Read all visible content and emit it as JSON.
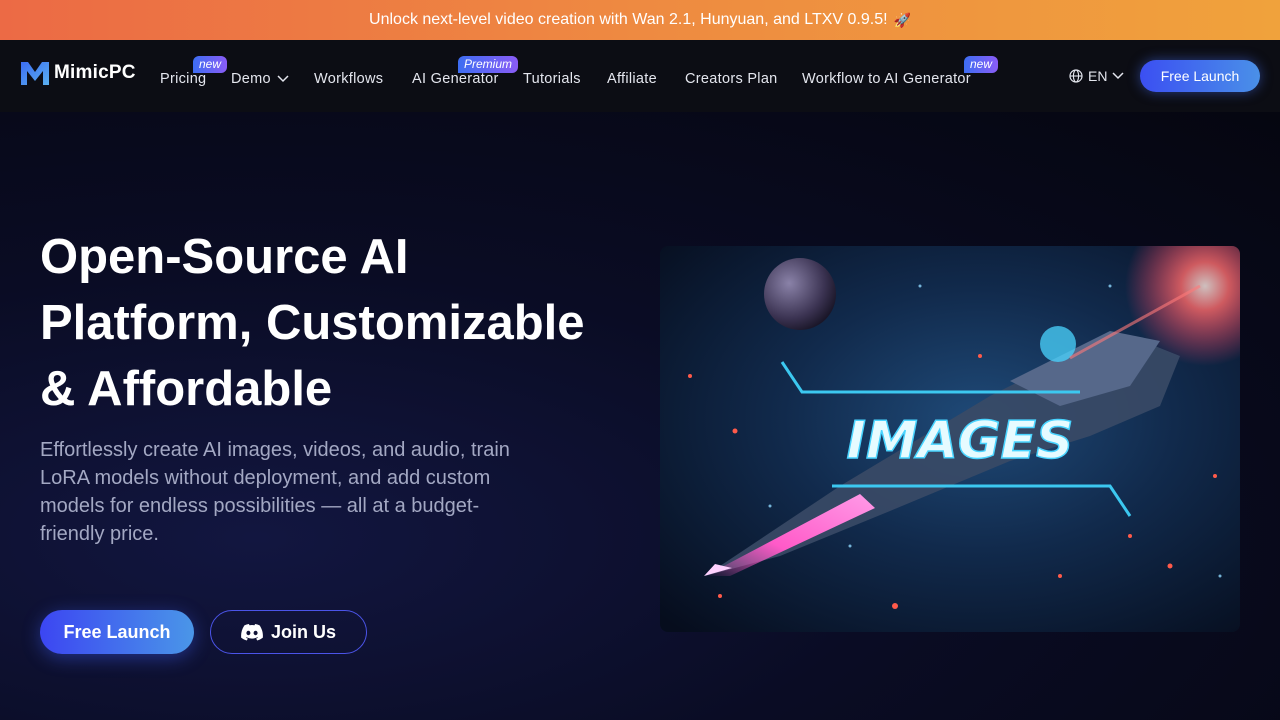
{
  "banner": {
    "text": "Unlock next-level video creation with Wan 2.1, Hunyuan, and LTXV 0.9.5!",
    "emoji": "🚀"
  },
  "nav": {
    "brand": "MimicPC",
    "items": [
      {
        "label": "Pricing",
        "badge": "new"
      },
      {
        "label": "Demo"
      },
      {
        "label": "Workflows"
      },
      {
        "label": "AI Generator",
        "badge": "Premium"
      },
      {
        "label": "Tutorials"
      },
      {
        "label": "Affiliate"
      },
      {
        "label": "Creators Plan"
      },
      {
        "label": "Workflow to AI Generator",
        "badge": "new"
      }
    ],
    "language": "EN",
    "launch_label": "Free Launch"
  },
  "hero": {
    "title": "Open-Source AI Platform, Customizable & Affordable",
    "description": "Effortlessly create AI images, videos, and audio, train LoRA models without deployment, and add custom models for endless possibilities — all at a budget-friendly price.",
    "primary_label": "Free Launch",
    "secondary_label": "Join Us",
    "image_text": "IMAGES"
  },
  "colors": {
    "banner_start": "#ec6a45",
    "banner_end": "#f0a23c",
    "accent": "#3c46f2",
    "badge": "#8a5cf6",
    "desc_text": "#a3a8c3"
  }
}
